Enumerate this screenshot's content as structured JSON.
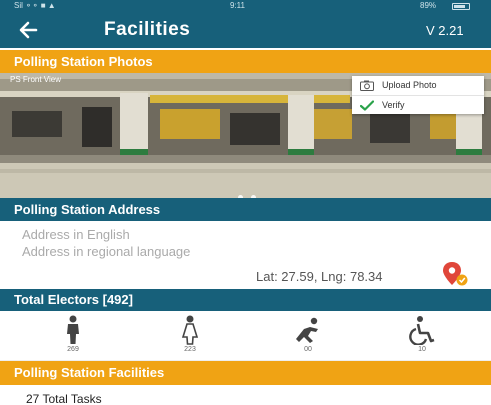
{
  "status_bar": {
    "left": "Sil ⚬⚬ ■ ▲",
    "time": "9:11",
    "right": "89%"
  },
  "app_bar": {
    "back_icon": "arrow-left-icon",
    "title": "Facilities",
    "version": "V 2.21"
  },
  "photos_section": {
    "header": "Polling Station Photos",
    "photo_label": "PS Front View",
    "menu": {
      "upload_label": "Upload Photo",
      "verify_label": "Verify"
    },
    "carousel_dots": 2
  },
  "address_section": {
    "header": "Polling Station Address",
    "address_english": "Address in English",
    "address_regional": "Address in regional language",
    "lat_lng": "Lat: 27.59, Lng: 78.34",
    "pin_icon": "map-pin-icon"
  },
  "electors_section": {
    "header": "Total Electors [492]",
    "items": [
      {
        "icon": "male-icon",
        "count": "269"
      },
      {
        "icon": "female-icon",
        "count": "223"
      },
      {
        "icon": "third-gender-icon",
        "count": "00"
      },
      {
        "icon": "wheelchair-icon",
        "count": "10"
      }
    ]
  },
  "facilities_section": {
    "header": "Polling Station Facilities",
    "tasks": "27 Total Tasks"
  },
  "colors": {
    "primary": "#17607a",
    "accent": "#f0a314",
    "verify_green": "#2aa24a",
    "pin_red": "#e0463a"
  }
}
